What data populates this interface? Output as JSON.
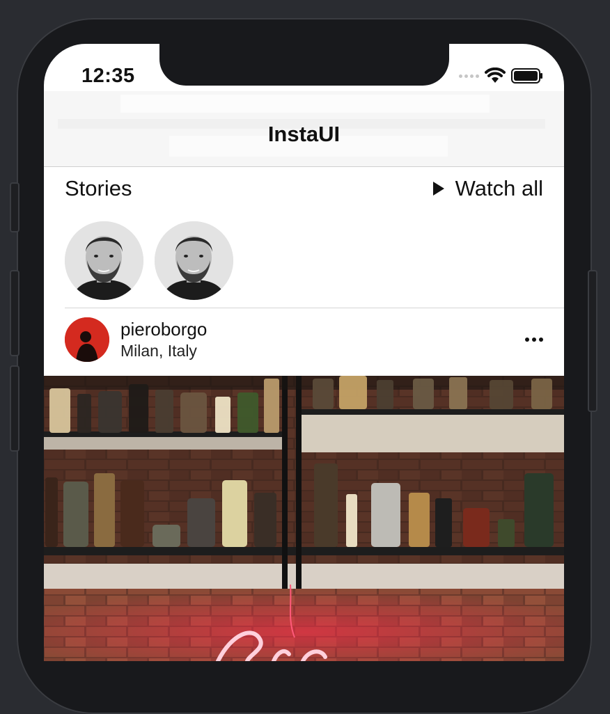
{
  "status_bar": {
    "time": "12:35"
  },
  "navbar": {
    "title": "InstaUI"
  },
  "stories": {
    "label": "Stories",
    "watch_all_label": "Watch all",
    "items": [
      {
        "icon": "avatar-person"
      },
      {
        "icon": "avatar-person"
      }
    ]
  },
  "post": {
    "username": "pieroborgo",
    "location": "Milan, Italy",
    "more_icon": "ellipsis-icon",
    "image_icon": "shelves-neon-photo"
  },
  "colors": {
    "frame": "#18191c",
    "background": "#2a2c31",
    "avatar_bg": "#d42a1f",
    "neon": "#ff3f6a"
  }
}
